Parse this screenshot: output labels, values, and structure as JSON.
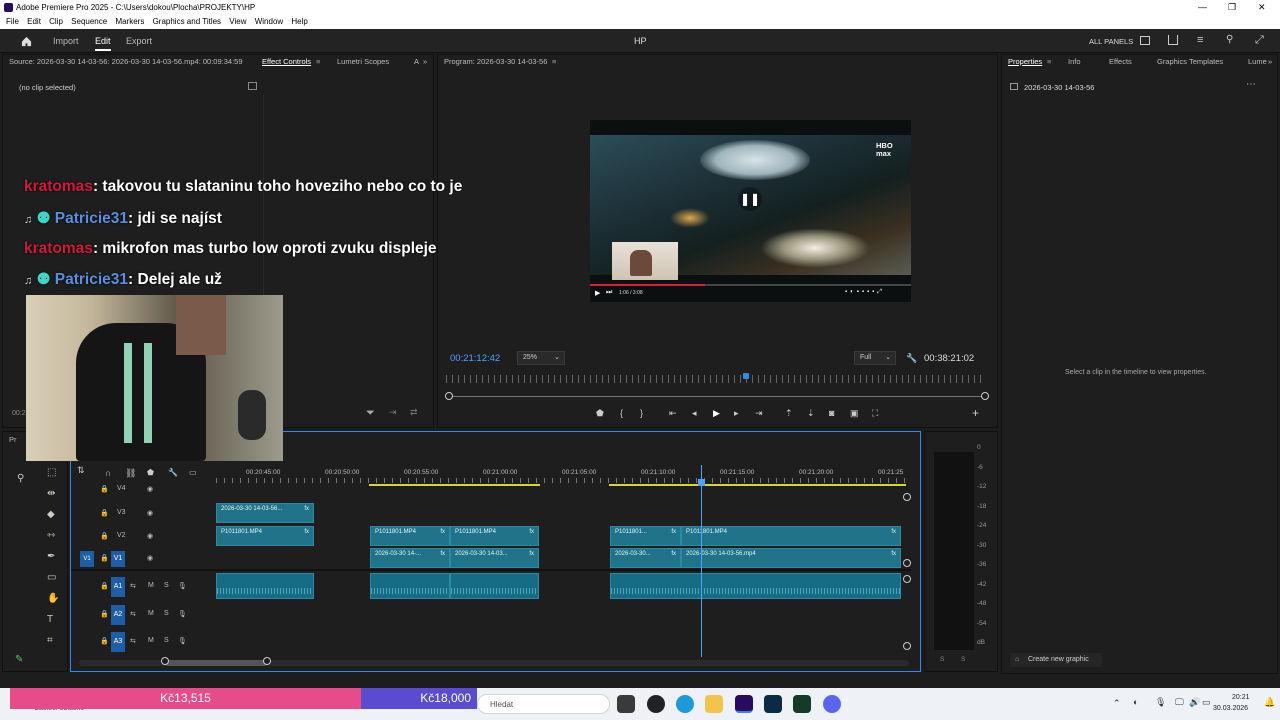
{
  "window": {
    "title": "Adobe Premiere Pro 2025 - C:\\Users\\dokou\\Plocha\\PROJEKTY\\HP",
    "controls": [
      "—",
      "❐",
      "✕"
    ]
  },
  "menu": [
    "File",
    "Edit",
    "Clip",
    "Sequence",
    "Markers",
    "Graphics and Titles",
    "View",
    "Window",
    "Help"
  ],
  "appbar": {
    "tabs": [
      "Import",
      "Edit",
      "Export"
    ],
    "active": "Edit",
    "project": "HP",
    "all_panels": "ALL PANELS"
  },
  "source_panel": {
    "source_label": "Source: 2026-03-30 14-03-56: 2026-03-30 14-03-56.mp4: 00:09:34:59",
    "tab_effect_controls": "Effect Controls",
    "tab_lumetri": "Lumetri Scopes",
    "tab_more": "A",
    "no_clip": "(no clip selected)",
    "timecode_partial": "00:2"
  },
  "program_panel": {
    "title": "Program: 2026-03-30 14-03-56",
    "timecode": "00:21:12:42",
    "zoom": "25%",
    "quality": "Full",
    "duration": "00:38:21:02",
    "video_logo": "HBO max",
    "video_time": "1:06 / 3:08",
    "playhead_fraction": 0.55
  },
  "properties_panel": {
    "tabs": [
      "Properties",
      "Info",
      "Effects",
      "Graphics Templates",
      "Lume"
    ],
    "clip_name": "2026-03-30 14-03-56",
    "empty_msg": "Select a clip in the timeline to view properties.",
    "create_graphic": "Create new graphic"
  },
  "chat": [
    {
      "user": "kratomas",
      "color": "#d2183b",
      "text": ": takovou tu slataninu toho hoveziho nebo co to je",
      "badges": false
    },
    {
      "user": "Patricie31",
      "color": "#5a8fe0",
      "text": ": jdi se najíst",
      "badges": true
    },
    {
      "user": "kratomas",
      "color": "#d2183b",
      "text": ": mikrofon mas turbo low oproti zvuku displeje",
      "badges": false
    },
    {
      "user": "Patricie31",
      "color": "#5a8fe0",
      "text": ": Delej ale už",
      "badges": true
    }
  ],
  "timeline": {
    "panel_label": "Pr",
    "ruler": [
      "00:20:45:00",
      "00:20:50:00",
      "00:20:55:00",
      "00:21:00:00",
      "00:21:05:00",
      "00:21:10:00",
      "00:21:15:00",
      "00:21:20:00",
      "00:21:25"
    ],
    "tracks_video": [
      "V4",
      "V3",
      "V2",
      "V1"
    ],
    "tracks_audio": [
      "A1",
      "A2",
      "A3"
    ],
    "v3_clips": [
      {
        "name": "2026-03-30 14-03-56..."
      }
    ],
    "v2_clips": [
      {
        "name": "P1011801.MP4"
      },
      {
        "name": "P1011801.MP4"
      },
      {
        "name": "P1011801.MP4"
      },
      {
        "name": "P1011801..."
      },
      {
        "name": "P1011801.MP4"
      }
    ],
    "v1_clips": [
      {
        "name": "2026-03-30 14-..."
      },
      {
        "name": "2026-03-30 14-03..."
      },
      {
        "name": "2026-03-30..."
      },
      {
        "name": "2026-03-30 14-03-56.mp4"
      }
    ],
    "fx": "fx",
    "mute": "M",
    "solo": "S"
  },
  "meter": {
    "scale": [
      "0",
      "-6",
      "-12",
      "-18",
      "-24",
      "-30",
      "-36",
      "-42",
      "-48",
      "-54",
      "dB"
    ],
    "bottom": [
      "S",
      "S"
    ]
  },
  "taskbar": {
    "overlay_left": "Kč13,515",
    "overlay_right": "Kč18,000",
    "weather": "Částeč. oblačno",
    "search": "Hledat",
    "time": "20:21",
    "date": "30.03.2026"
  },
  "colors": {
    "accent": "#2d8ceb",
    "clip": "#207389",
    "pink": "#e84b8a",
    "purple": "#5a4bd0"
  }
}
